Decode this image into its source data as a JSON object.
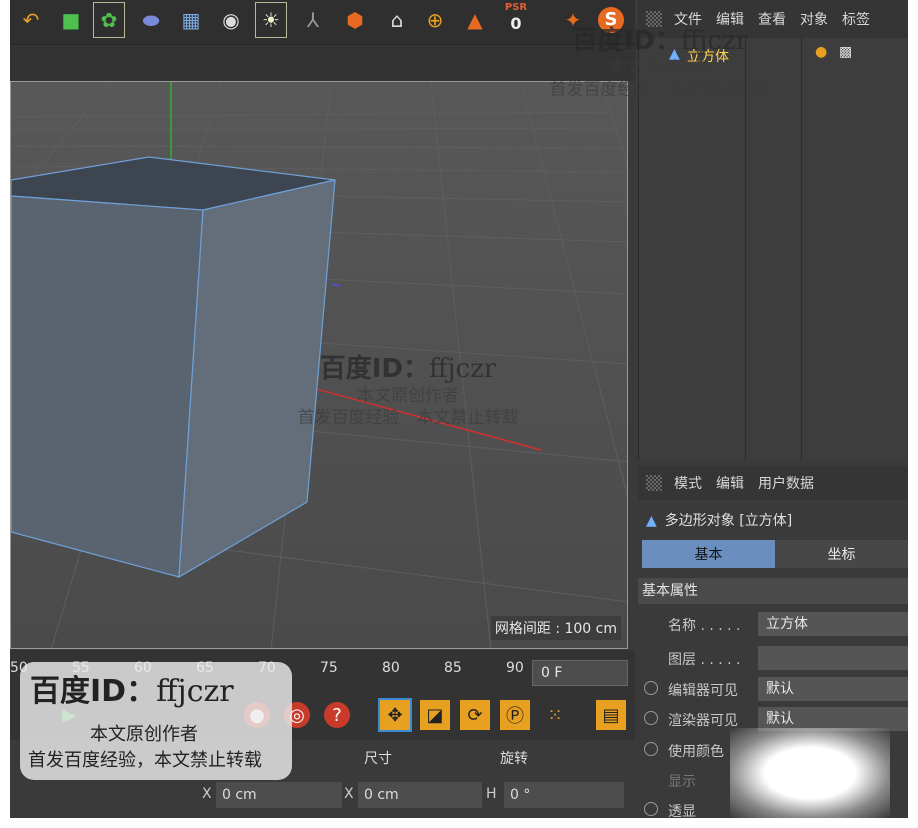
{
  "toolbar": {
    "icons": [
      "undo-icon",
      "cube-icon",
      "cloner-icon",
      "deformer-icon",
      "grid-icon",
      "camera-icon",
      "light-icon",
      "axis-icon",
      "tag-icon",
      "render-icon",
      "coord-icon",
      "redo-icon"
    ],
    "psr_label": "PSR",
    "psr_value": "0",
    "s_icon": "S"
  },
  "object_manager": {
    "menu": [
      "文件",
      "编辑",
      "查看",
      "对象",
      "标签"
    ],
    "object_name": "立方体"
  },
  "viewport": {
    "grid_spacing": "网格间距 : 100 cm"
  },
  "attribute_manager": {
    "menu": [
      "模式",
      "编辑",
      "用户数据"
    ],
    "title": "多边形对象 [立方体]",
    "tabs": [
      "基本",
      "坐标"
    ],
    "section": "基本属性",
    "props": [
      {
        "label": "名称 . . . . .",
        "value": "立方体"
      },
      {
        "label": "图层 . . . . .",
        "value": ""
      },
      {
        "label": "编辑器可见",
        "value": "默认"
      },
      {
        "label": "渲染器可见",
        "value": "默认"
      },
      {
        "label": "使用颜色",
        "value": ""
      },
      {
        "label": "显示",
        "value": ""
      },
      {
        "label": "透显",
        "value": ""
      }
    ]
  },
  "timeline": {
    "ticks": [
      "50",
      "55",
      "60",
      "65",
      "70",
      "75",
      "80",
      "85",
      "90"
    ],
    "frame": "0 F"
  },
  "coords": {
    "headers": [
      "尺寸",
      "旋转"
    ],
    "x_pos": "0 cm",
    "x_size": "0 cm",
    "h_rot": "0 °",
    "axis_x": "X",
    "axis_x2": "X",
    "axis_h": "H"
  },
  "watermark": {
    "id": "百度ID：",
    "id_name": "ffjczr",
    "line1": "本文原创作者",
    "line2": "首发百度经验　本文禁止转载",
    "line2b": "首发百度经验，本文禁止转载"
  },
  "colors": {
    "selection_blue": "#6a8fbf",
    "object_yellow": "#ffd34a",
    "x_axis": "#e03030",
    "y_axis": "#30c030"
  }
}
